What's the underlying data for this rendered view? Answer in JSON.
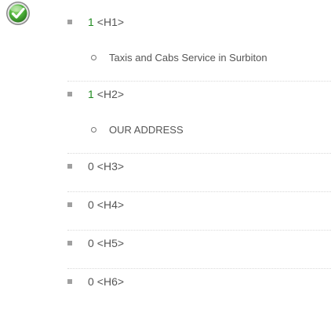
{
  "icons": {
    "status": "check-circle-icon"
  },
  "colors": {
    "found_count": "#1f8a1f",
    "badge_green": "#4caf3a"
  },
  "headings": [
    {
      "count": "1",
      "tag": "<H1>",
      "found": true,
      "items": [
        "Taxis and Cabs Service in Surbiton"
      ]
    },
    {
      "count": "1",
      "tag": "<H2>",
      "found": true,
      "items": [
        "OUR ADDRESS"
      ]
    },
    {
      "count": "0",
      "tag": "<H3>",
      "found": false,
      "items": []
    },
    {
      "count": "0",
      "tag": "<H4>",
      "found": false,
      "items": []
    },
    {
      "count": "0",
      "tag": "<H5>",
      "found": false,
      "items": []
    },
    {
      "count": "0",
      "tag": "<H6>",
      "found": false,
      "items": []
    }
  ]
}
